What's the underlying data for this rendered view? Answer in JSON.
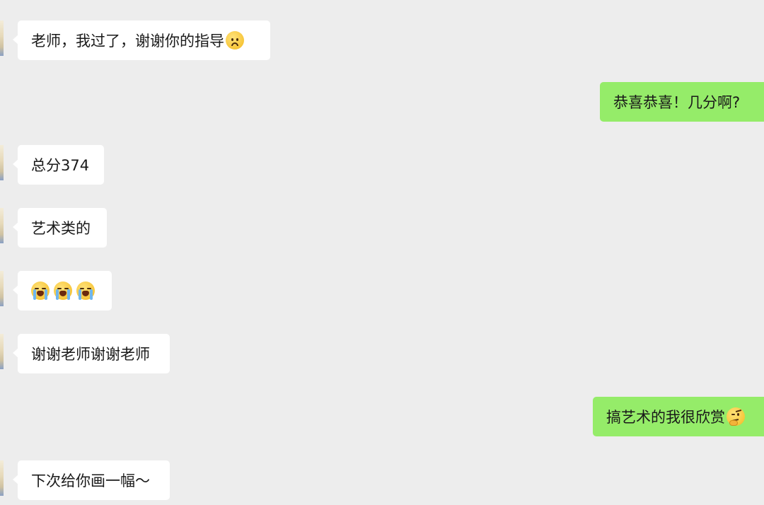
{
  "messages": [
    {
      "side": "left",
      "text": "老师，我过了，谢谢你的指导",
      "emoji": [
        "sad-face"
      ]
    },
    {
      "side": "right",
      "text": "恭喜恭喜！几分啊?"
    },
    {
      "side": "left",
      "text": "总分374"
    },
    {
      "side": "left",
      "text": "艺术类的"
    },
    {
      "side": "left",
      "text": "",
      "emoji": [
        "crying-face",
        "crying-face",
        "crying-face"
      ]
    },
    {
      "side": "left",
      "text": "谢谢老师谢谢老师"
    },
    {
      "side": "right",
      "text": "搞艺术的我很欣赏",
      "emoji": [
        "thinking-face"
      ]
    },
    {
      "side": "left",
      "text": "下次给你画一幅～"
    }
  ],
  "colors": {
    "background": "#ededed",
    "incoming_bubble": "#ffffff",
    "outgoing_bubble": "#95ec69",
    "text": "#191919"
  }
}
